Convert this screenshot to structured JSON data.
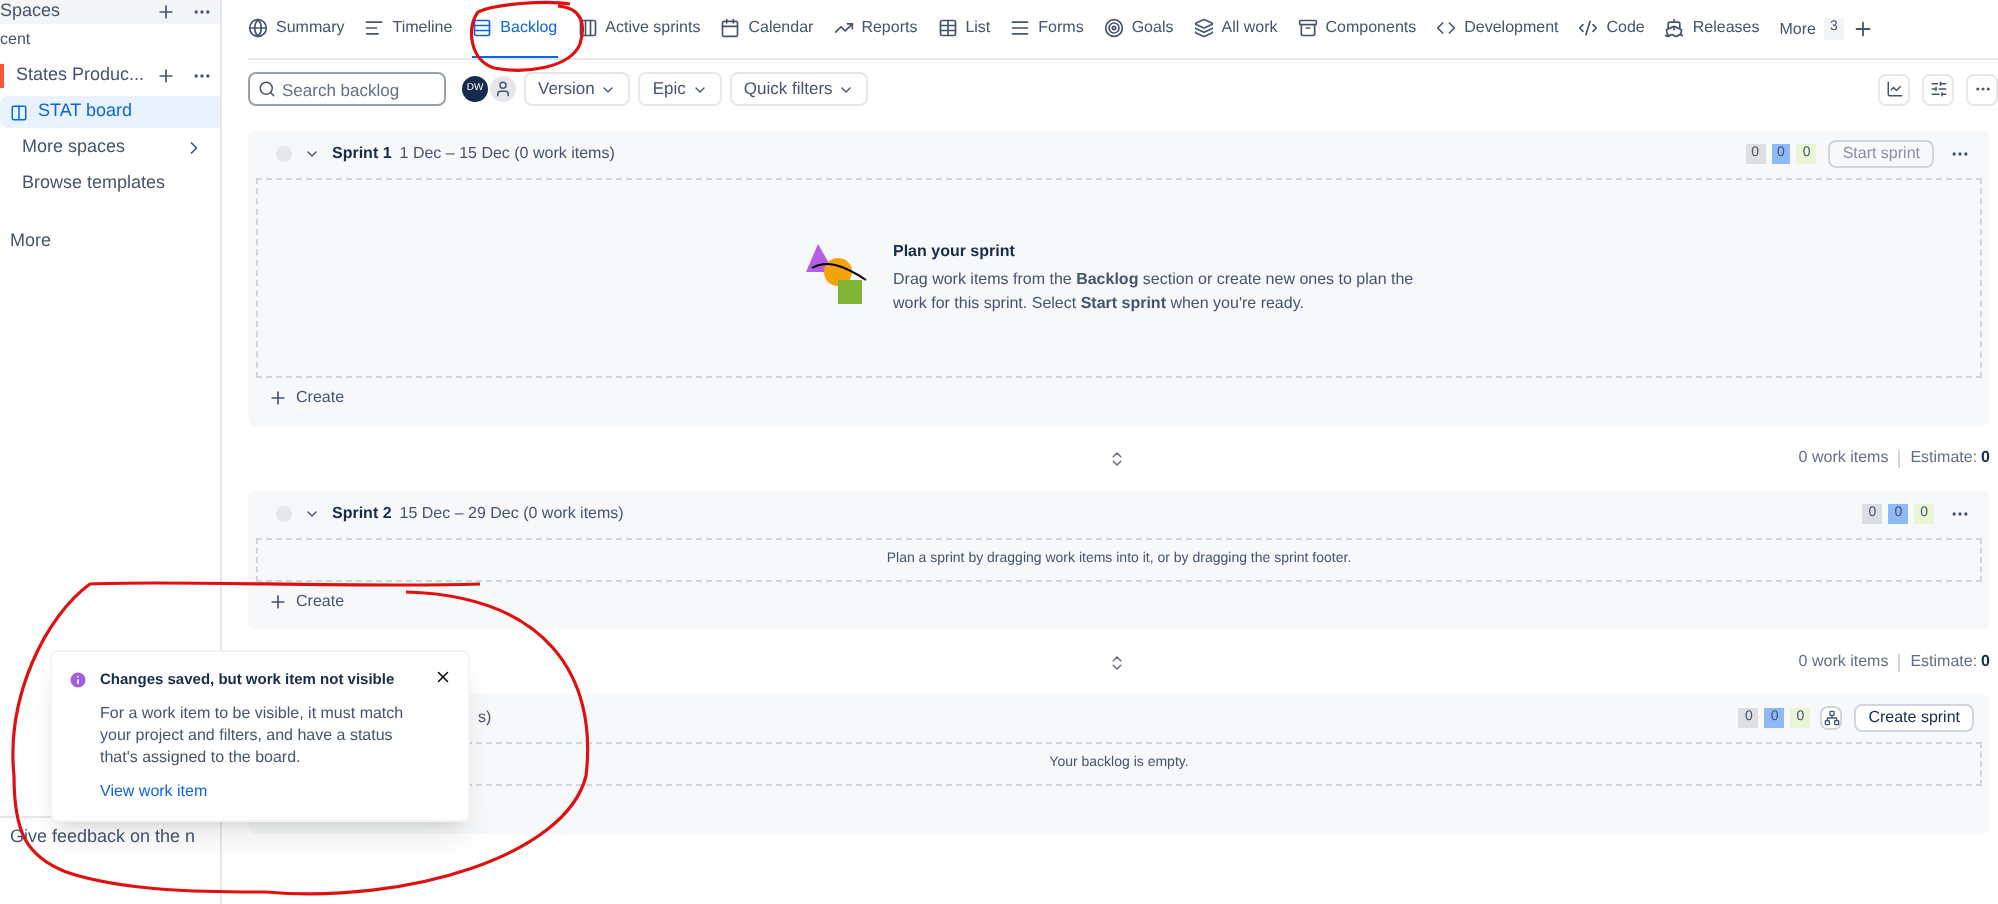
{
  "sidebar": {
    "header": "Spaces",
    "section": "cent",
    "items": [
      {
        "kind": "space",
        "label": "States Produc...",
        "color": "#f15b3a",
        "selected": false
      },
      {
        "kind": "board",
        "label": "STAT board",
        "selected": true
      },
      {
        "kind": "more",
        "label": "More spaces",
        "selected": false
      },
      {
        "kind": "plain",
        "label": "Browse templates",
        "selected": false
      }
    ],
    "more": "More",
    "feedback": "Give feedback on the n"
  },
  "tabs": [
    {
      "label": "Summary",
      "selected": false
    },
    {
      "label": "Timeline",
      "selected": false
    },
    {
      "label": "Backlog",
      "selected": true
    },
    {
      "label": "Active sprints",
      "selected": false
    },
    {
      "label": "Calendar",
      "selected": false
    },
    {
      "label": "Reports",
      "selected": false
    },
    {
      "label": "List",
      "selected": false
    },
    {
      "label": "Forms",
      "selected": false
    },
    {
      "label": "Goals",
      "selected": false
    },
    {
      "label": "All work",
      "selected": false
    },
    {
      "label": "Components",
      "selected": false
    },
    {
      "label": "Development",
      "selected": false
    },
    {
      "label": "Code",
      "selected": false
    },
    {
      "label": "Releases",
      "selected": false
    }
  ],
  "more_tab": {
    "label": "More",
    "count": "3"
  },
  "toolbar": {
    "search": {
      "placeholder": "Search backlog"
    },
    "avatar": "DW",
    "filters": [
      "Version",
      "Epic",
      "Quick filters"
    ]
  },
  "sections": [
    {
      "kind": "sprint",
      "checked": false,
      "name": "Sprint 1",
      "dates": "1 Dec – 15 Dec (0 work items)",
      "counts": [
        {
          "value": "0",
          "color": "#dddee1"
        },
        {
          "value": "0",
          "color": "#8fb8f6"
        },
        {
          "value": "0",
          "color": "#e9f5d5"
        }
      ],
      "action": {
        "label": "Start sprint",
        "disabled": true
      },
      "empty": {
        "kind": "illustrated",
        "title": "Plan your sprint",
        "text": "Drag work items from the **Backlog** section or create new ones to plan the work for this sprint. Select **Start sprint** when you're ready."
      },
      "create": "Create",
      "footer": {
        "items": "0 work items",
        "estimate_label": "Estimate:",
        "estimate": "0"
      }
    },
    {
      "kind": "sprint",
      "checked": false,
      "name": "Sprint 2",
      "dates": "15 Dec – 29 Dec (0 work items)",
      "counts": [
        {
          "value": "0",
          "color": "#dddee1"
        },
        {
          "value": "0",
          "color": "#8fb8f6"
        },
        {
          "value": "0",
          "color": "#e9f5d5"
        }
      ],
      "empty": {
        "kind": "plain",
        "text": "Plan a sprint by dragging work items into it, or by dragging the sprint footer."
      },
      "create": "Create",
      "footer": {
        "items": "0 work items",
        "estimate_label": "Estimate:",
        "estimate": "0"
      }
    },
    {
      "kind": "backlog",
      "dates": "s)",
      "counts": [
        {
          "value": "0",
          "color": "#dddee1"
        },
        {
          "value": "0",
          "color": "#8fb8f6"
        },
        {
          "value": "0",
          "color": "#e9f5d5"
        }
      ],
      "action": {
        "label": "Create sprint",
        "disabled": false
      },
      "empty": {
        "kind": "plain",
        "text": "Your backlog is empty."
      }
    }
  ],
  "toast": {
    "title": "Changes saved, but work item not visible",
    "text": "For a work item to be visible, it must match your project and filters, and have a status that's assigned to the board.",
    "link": "View work item"
  }
}
